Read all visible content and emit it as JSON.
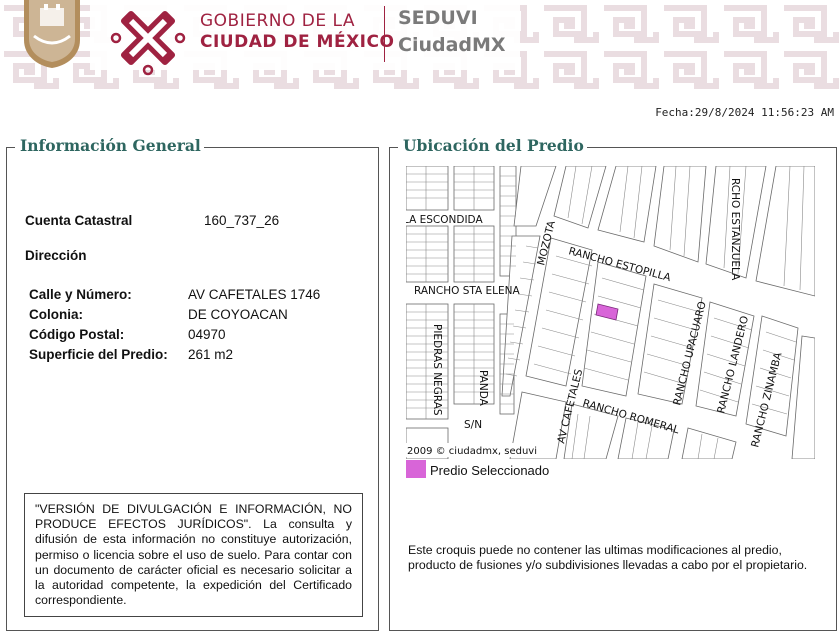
{
  "header": {
    "gov_line1": "GOBIERNO DE LA",
    "gov_line2": "CIUDAD DE MÉXICO",
    "seduvi_line1": "SEDUVI",
    "seduvi_line2": "CiudadMX",
    "brand_color": "#9f2241",
    "seal_icon": "cdmx-coat-of-arms-icon",
    "logo_icon": "cdmx-logo-icon"
  },
  "fecha": "Fecha:29/8/2024 11:56:23 AM",
  "general": {
    "title": "Información General",
    "cuenta_label": "Cuenta Catastral",
    "cuenta_value": "160_737_26",
    "direccion_label": "Dirección",
    "fields": [
      {
        "label": "Calle y Número:",
        "value": "AV CAFETALES 1746"
      },
      {
        "label": "Colonia:",
        "value": "DE COYOACAN"
      },
      {
        "label": "Código Postal:",
        "value": "04970"
      },
      {
        "label": "Superficie del Predio:",
        "value": "261 m2"
      }
    ],
    "disclaimer": "\"VERSIÓN DE DIVULGACIÓN E INFORMACIÓN, NO PRODUCE EFECTOS JURÍDICOS\". La consulta y difusión de esta información no constituye autorización, permiso o licencia sobre el uso de suelo. Para contar con un documento de carácter oficial es necesario solicitar a la autoridad competente, la expedición del Certificado correspondiente."
  },
  "ubicacion": {
    "title": "Ubicación del Predio",
    "streets": {
      "la_escondida": "LA ESCONDIDA",
      "mozota": "MOZOTA",
      "rancho_estopilla": "RANCHO ESTOPILLA",
      "rcho_estanzuela": "RCHO ESTANZUELA",
      "rancho_sta_elena": "RANCHO STA ELENA",
      "piedras_negras": "PIEDRAS NEGRAS",
      "panda": "PANDA",
      "sn": "S/N",
      "av_cafetales": "AV CAFETALES",
      "rancho_romeral": "RANCHO ROMERAL",
      "rancho_upacuaro": "RANCHO UPACUARO",
      "rancho_landero": "RANCHO LANDERO",
      "rancho_zinamba": "RANCHO ZINAMBA"
    },
    "copyright": "2009 © ciudadmx, seduvi",
    "legend_label": "Predio Seleccionado",
    "highlight_color": "#d865d8",
    "note": "Este croquis puede no contener las ultimas modificaciones al predio, producto de fusiones y/o subdivisiones llevadas a cabo por el propietario."
  }
}
